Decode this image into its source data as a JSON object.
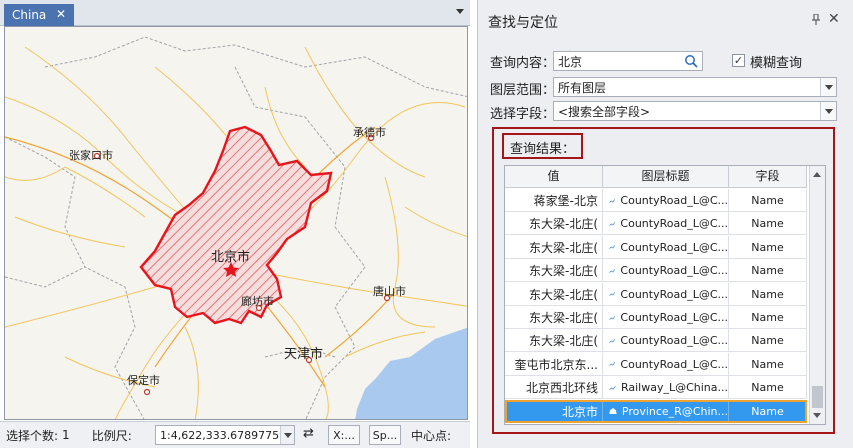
{
  "map_window": {
    "tab_label": "China",
    "tab_close": "✕",
    "labels": {
      "zhangjiakou": "张家口市",
      "chengde": "承德市",
      "beijing": "北京市",
      "langfang": "廊坊市",
      "tangshan": "唐山市",
      "tianjin": "天津市",
      "baoding": "保定市"
    }
  },
  "statusbar": {
    "selected_count_label": "选择个数:",
    "selected_count_value": "1",
    "scale_label": "比例尺:",
    "scale_value": "1:4,622,333.67897759",
    "swap_icon": "⇄",
    "x_button": "X:...",
    "sp_button": "Sp...",
    "center_label": "中心点:"
  },
  "panel": {
    "title": "查找与定位",
    "pin_icon": "pin-icon",
    "close_glyph": "✕",
    "query_label": "查询内容：",
    "query_value": "北京",
    "fuzzy_checked": true,
    "fuzzy_label": "模糊查询",
    "layer_scope_label": "图层范围：",
    "layer_scope_value": "所有图层",
    "field_label": "选择字段：",
    "field_value": "<搜索全部字段>",
    "results_label": "查询结果：",
    "columns": [
      "值",
      "图层标题",
      "字段"
    ],
    "rows": [
      {
        "value": "蒋家堡-北京",
        "layer": "CountyRoad_L@C...",
        "field": "Name",
        "icon": "line",
        "selected": false
      },
      {
        "value": "东大梁-北庄(",
        "layer": "CountyRoad_L@C...",
        "field": "Name",
        "icon": "line",
        "selected": false
      },
      {
        "value": "东大梁-北庄(",
        "layer": "CountyRoad_L@C...",
        "field": "Name",
        "icon": "line",
        "selected": false
      },
      {
        "value": "东大梁-北庄(",
        "layer": "CountyRoad_L@C...",
        "field": "Name",
        "icon": "line",
        "selected": false
      },
      {
        "value": "东大梁-北庄(",
        "layer": "CountyRoad_L@C...",
        "field": "Name",
        "icon": "line",
        "selected": false
      },
      {
        "value": "东大梁-北庄(",
        "layer": "CountyRoad_L@C...",
        "field": "Name",
        "icon": "line",
        "selected": false
      },
      {
        "value": "东大梁-北庄(",
        "layer": "CountyRoad_L@C...",
        "field": "Name",
        "icon": "line",
        "selected": false
      },
      {
        "value": "奎屯市北京东...",
        "layer": "CountyRoad_L@C...",
        "field": "Name",
        "icon": "line",
        "selected": false
      },
      {
        "value": "北京西北环线",
        "layer": "Railway_L@China...",
        "field": "Name",
        "icon": "line",
        "selected": false
      },
      {
        "value": "北京市",
        "layer": "Province_R@Chin...",
        "field": "Name",
        "icon": "region",
        "selected": true
      }
    ]
  },
  "colors": {
    "tab_active": "#4b73b0",
    "highlight_red": "#e8141c",
    "selected_row": "#3399ee",
    "selected_outline": "#f0a22e",
    "result_frame": "#a4161a",
    "water": "#a9c9ee"
  }
}
